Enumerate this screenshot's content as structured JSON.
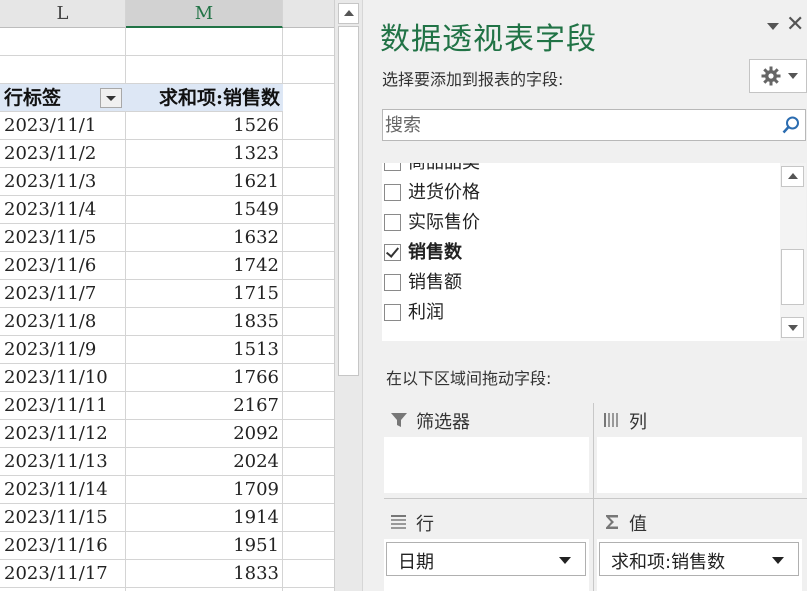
{
  "sheet": {
    "columns": [
      "L",
      "M"
    ],
    "pivot_header": {
      "row_label": "行标签",
      "value_label": "求和项:销售数"
    },
    "rows": [
      {
        "date": "2023/11/1",
        "value": "1526"
      },
      {
        "date": "2023/11/2",
        "value": "1323"
      },
      {
        "date": "2023/11/3",
        "value": "1621"
      },
      {
        "date": "2023/11/4",
        "value": "1549"
      },
      {
        "date": "2023/11/5",
        "value": "1632"
      },
      {
        "date": "2023/11/6",
        "value": "1742"
      },
      {
        "date": "2023/11/7",
        "value": "1715"
      },
      {
        "date": "2023/11/8",
        "value": "1835"
      },
      {
        "date": "2023/11/9",
        "value": "1513"
      },
      {
        "date": "2023/11/10",
        "value": "1766"
      },
      {
        "date": "2023/11/11",
        "value": "2167"
      },
      {
        "date": "2023/11/12",
        "value": "2092"
      },
      {
        "date": "2023/11/13",
        "value": "2024"
      },
      {
        "date": "2023/11/14",
        "value": "1709"
      },
      {
        "date": "2023/11/15",
        "value": "1914"
      },
      {
        "date": "2023/11/16",
        "value": "1951"
      },
      {
        "date": "2023/11/17",
        "value": "1833"
      }
    ]
  },
  "pane": {
    "title": "数据透视表字段",
    "close_glyph": "✕",
    "choose_label": "选择要添加到报表的字段:",
    "search": {
      "placeholder": "搜索",
      "value": ""
    },
    "fields": [
      {
        "label": "商品品类",
        "checked": false
      },
      {
        "label": "进货价格",
        "checked": false
      },
      {
        "label": "实际售价",
        "checked": false
      },
      {
        "label": "销售数",
        "checked": true
      },
      {
        "label": "销售额",
        "checked": false
      },
      {
        "label": "利润",
        "checked": false
      }
    ],
    "drag_label": "在以下区域间拖动字段:",
    "areas": {
      "filter": {
        "title": "筛选器",
        "icon": "filter-icon"
      },
      "columns": {
        "title": "列",
        "icon": "columns-icon"
      },
      "rows": {
        "title": "行",
        "icon": "rows-icon",
        "item": "日期"
      },
      "values": {
        "title": "值",
        "icon": "sigma-icon",
        "item": "求和项:销售数"
      }
    }
  },
  "colors": {
    "accent": "#217346",
    "header_fill": "#dde7f5",
    "pane_bg": "#f0f0f0"
  }
}
